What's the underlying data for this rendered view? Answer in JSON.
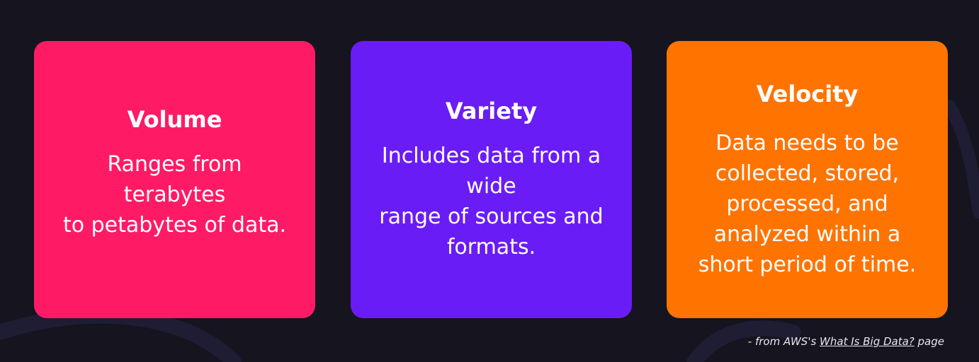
{
  "colors": {
    "background": "#15141f",
    "volume_card": "#ff1a66",
    "variety_card": "#6a1cf6",
    "velocity_card": "#ff7300"
  },
  "cards": [
    {
      "title": "Volume",
      "body": "Ranges from\nterabytes\nto petabytes of data."
    },
    {
      "title": "Variety",
      "body": "Includes data from a\nwide\nrange of sources and\nformats."
    },
    {
      "title": "Velocity",
      "body": "Data needs to be\ncollected, stored,\nprocessed, and\nanalyzed within a\nshort period of time."
    }
  ],
  "attribution": {
    "prefix": "- from AWS's ",
    "link_text": "What Is Big Data?",
    "suffix": " page"
  }
}
